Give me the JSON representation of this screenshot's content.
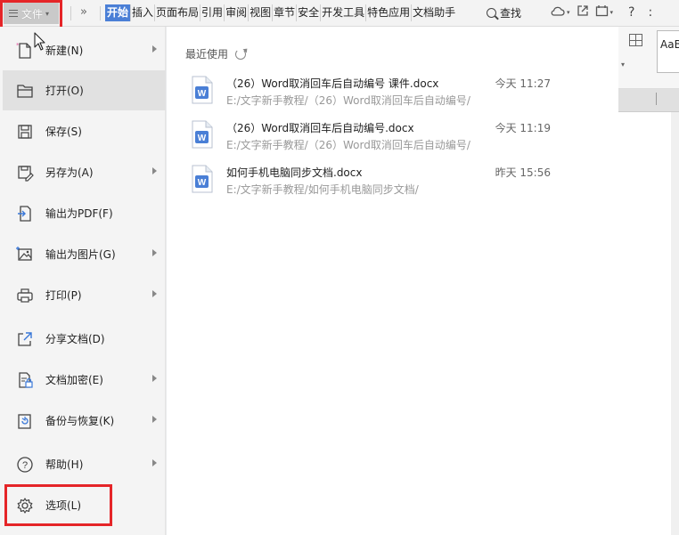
{
  "toolbar": {
    "file_label": "文件",
    "more_symbol": "»",
    "tabs": [
      "开始",
      "插入",
      "页面布局",
      "引用",
      "审阅",
      "视图",
      "章节",
      "安全",
      "开发工具",
      "特色应用",
      "文档助手"
    ],
    "search_label": "查找",
    "help_symbol": "?",
    "more_menu_symbol": ":"
  },
  "ribbon": {
    "style_preview": "AaB"
  },
  "file_menu": {
    "items": [
      {
        "label": "新建(N)",
        "icon": "new-file-icon",
        "submenu": true
      },
      {
        "label": "打开(O)",
        "icon": "open-folder-icon",
        "submenu": false
      },
      {
        "label": "保存(S)",
        "icon": "save-icon",
        "submenu": false
      },
      {
        "label": "另存为(A)",
        "icon": "save-as-icon",
        "submenu": true
      },
      {
        "label": "输出为PDF(F)",
        "icon": "export-pdf-icon",
        "submenu": false
      },
      {
        "label": "输出为图片(G)",
        "icon": "export-image-icon",
        "submenu": true
      },
      {
        "label": "打印(P)",
        "icon": "print-icon",
        "submenu": true
      },
      {
        "label": "分享文档(D)",
        "icon": "share-icon",
        "submenu": false
      },
      {
        "label": "文档加密(E)",
        "icon": "encrypt-icon",
        "submenu": true
      },
      {
        "label": "备份与恢复(K)",
        "icon": "backup-icon",
        "submenu": true
      },
      {
        "label": "帮助(H)",
        "icon": "help-icon",
        "submenu": true
      },
      {
        "label": "选项(L)",
        "icon": "gear-icon",
        "submenu": false
      }
    ],
    "selected_index": 1
  },
  "recent": {
    "title": "最近使用",
    "files": [
      {
        "name": "（26）Word取消回车后自动编号 课件.docx",
        "path": "E:/文字新手教程/（26）Word取消回车后自动编号/",
        "time": "今天 11:27"
      },
      {
        "name": "（26）Word取消回车后自动编号.docx",
        "path": "E:/文字新手教程/（26）Word取消回车后自动编号/",
        "time": "今天 11:19"
      },
      {
        "name": "如何手机电脑同步文档.docx",
        "path": "E:/文字新手教程/如何手机电脑同步文档/",
        "time": "昨天 15:56"
      }
    ]
  },
  "colors": {
    "accent_blue": "#4a7fd6",
    "highlight_red": "#e52528",
    "word_icon_blue": "#4a7fd6"
  }
}
